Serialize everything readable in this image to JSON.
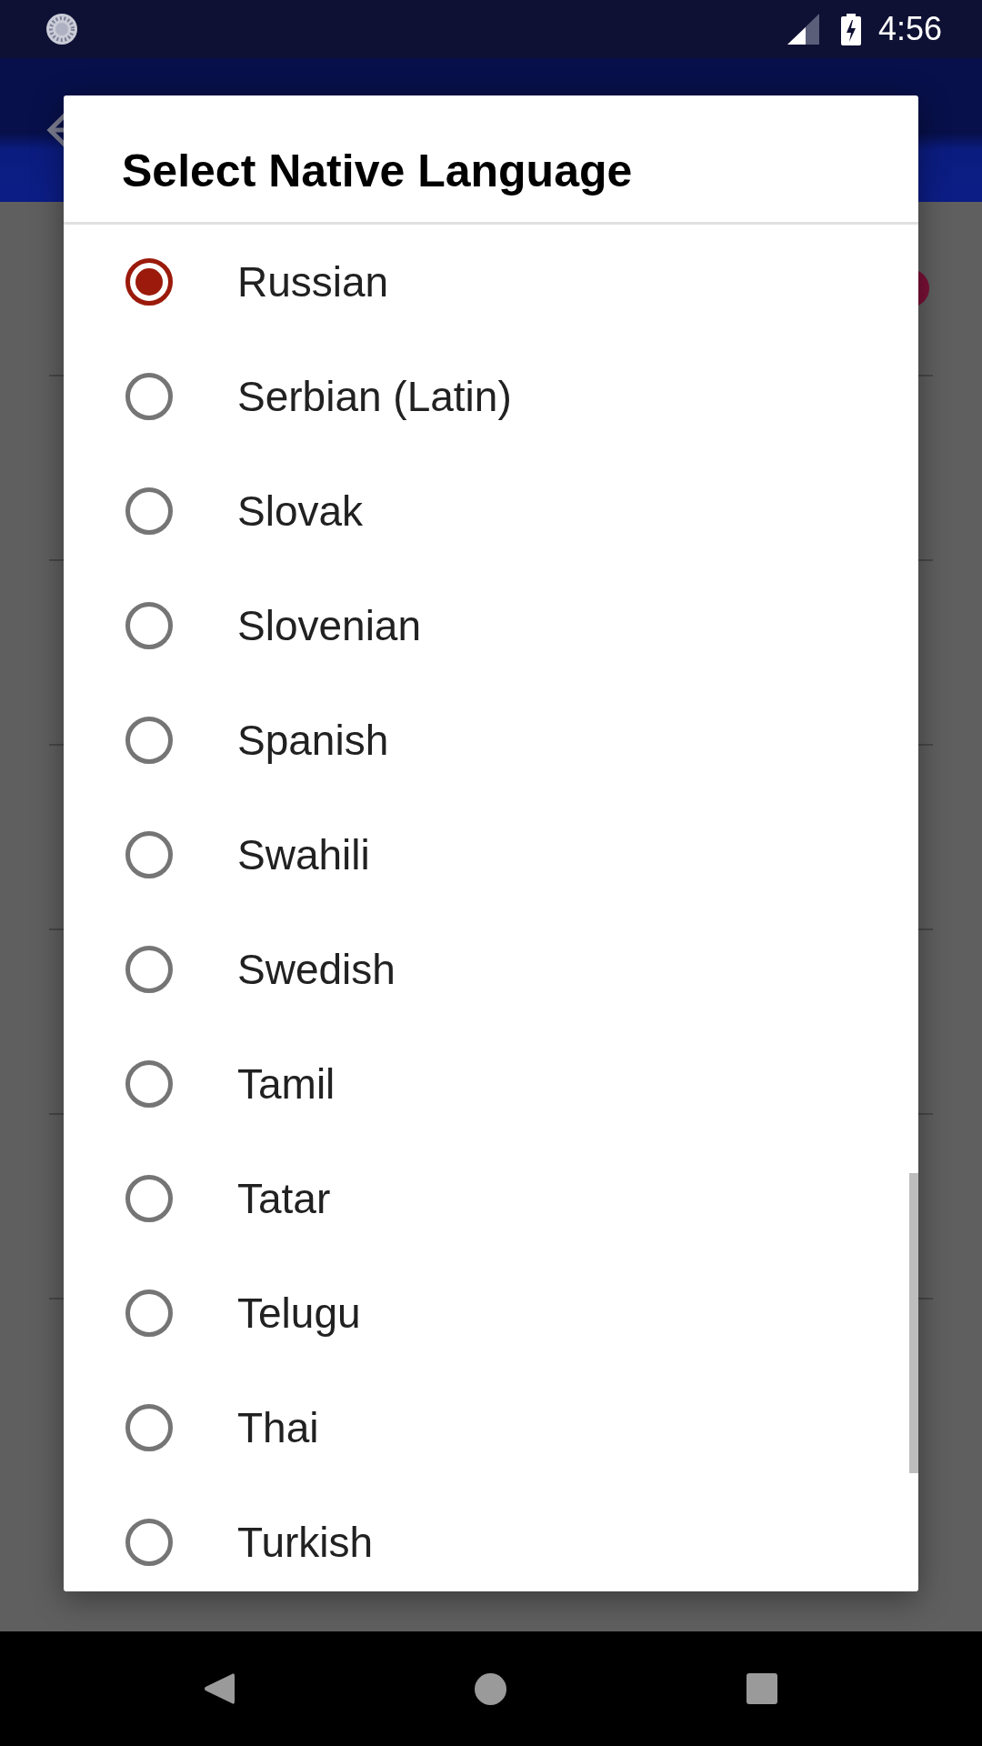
{
  "status_bar": {
    "time": "4:56"
  },
  "background_list": {
    "items": [
      {
        "dot": true
      },
      {
        "dot": false
      },
      {
        "dot": false
      },
      {
        "dot": false
      },
      {
        "dot": false
      },
      {
        "dot": false
      }
    ]
  },
  "dialog": {
    "title": "Select Native Language",
    "options": [
      {
        "label": "Russian",
        "selected": true
      },
      {
        "label": "Serbian (Latin)",
        "selected": false
      },
      {
        "label": "Slovak",
        "selected": false
      },
      {
        "label": "Slovenian",
        "selected": false
      },
      {
        "label": "Spanish",
        "selected": false
      },
      {
        "label": "Swahili",
        "selected": false
      },
      {
        "label": "Swedish",
        "selected": false
      },
      {
        "label": "Tamil",
        "selected": false
      },
      {
        "label": "Tatar",
        "selected": false
      },
      {
        "label": "Telugu",
        "selected": false
      },
      {
        "label": "Thai",
        "selected": false
      },
      {
        "label": "Turkish",
        "selected": false
      }
    ]
  }
}
